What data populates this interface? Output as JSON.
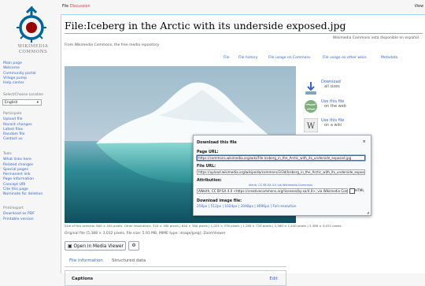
{
  "logo": {
    "line1": "WIKIMEDIA",
    "line2": "COMMONS"
  },
  "sidebar": {
    "nav": [
      "Main page",
      "Welcome",
      "Community portal",
      "Village pump",
      "Help center"
    ],
    "lang_heading": "Select/Choose Location",
    "lang_value": "English",
    "participate_heading": "Participate",
    "participate": [
      "Upload file",
      "Recent changes",
      "Latest files",
      "Random file",
      "Contact us"
    ],
    "tools_heading": "Tools",
    "tools": [
      "What links here",
      "Related changes",
      "Special pages",
      "Permanent link",
      "Page information",
      "Concept URI",
      "Cite this page",
      "Nominate for deletion"
    ],
    "print_heading": "Print/export",
    "print": [
      "Download as PDF",
      "Printable version"
    ]
  },
  "topbar": {
    "tab_file": "File",
    "tab_discussion": "Discussion",
    "tab_view": "View"
  },
  "page": {
    "title": "File:Iceberg in the Arctic with its underside exposed.jpg",
    "available": "Wikimedia Commons está disponible en español",
    "from": "From Wikimedia Commons, the free media repository",
    "file_tabs": [
      "File",
      "File history",
      "File usage on Commons",
      "File usage on other wikis",
      "Metadata"
    ],
    "size_note": "Size of this preview: 800 × 450 pixels. Other resolutions: 320 × 180 pixels | 640 × 360 pixels | 1,024 × 576 pixels | 1,280 × 720 pixels | 2,560 × 1,440 pixels | 5,388 × 3,032 pixels.",
    "original": "Original file (5,388 × 3,032 pixels, file size: 5.93 MB, MIME type: image/jpeg); ZoomViewer",
    "open_viewer": "Open in Media Viewer",
    "bottom_tabs": [
      "File information",
      "Structured data"
    ],
    "captions": "Captions",
    "edit": "Edit"
  },
  "reuse": [
    {
      "label": "Download",
      "sub": "all sizes"
    },
    {
      "label": "Use this file",
      "sub": "on the web"
    },
    {
      "label": "Use this file",
      "sub": "on a wiki"
    }
  ],
  "dialog": {
    "title": "Download this file",
    "close": "×",
    "page_url_label": "Page URL:",
    "page_url": "https://commons.wikimedia.org/wiki/File:Iceberg_in_the_Arctic_with_its_underside_exposed.jpg",
    "file_url_label": "File URL:",
    "file_url": "https://upload.wikimedia.org/wikipedia/commons/3/3d/Iceberg_in_the_Arctic_with_its_underside_exposed.jpg",
    "attribution_label": "Attribution:",
    "attribution_hint": "Attrib, CC BY-SA 4.0 via Wikimedia Commons",
    "attribution_value": "AWeith, CC BY-SA 4.0 <https://creativecommons.org/licenses/by-sa/4.0>, via Wikimedia Commons",
    "html_label": "HTML",
    "image_label": "Download image file:",
    "image_sizes": "256px | 512px | 1024px | 2048px | 4096px | Full resolution"
  }
}
